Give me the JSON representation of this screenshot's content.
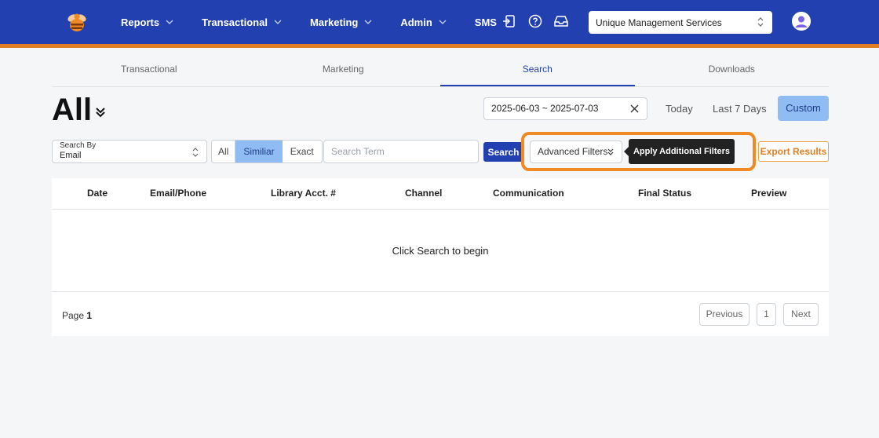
{
  "brand": {
    "logo": "bee-logo",
    "accent": "#2340b1",
    "stripe": "#e07e23"
  },
  "nav": {
    "items": [
      {
        "label": "Reports",
        "dropdown": true
      },
      {
        "label": "Transactional",
        "dropdown": true
      },
      {
        "label": "Marketing",
        "dropdown": true
      },
      {
        "label": "Admin",
        "dropdown": true
      },
      {
        "label": "SMS",
        "dropdown": false
      }
    ],
    "icons": [
      "logout-icon",
      "help-icon",
      "inbox-icon"
    ],
    "org_select": "Unique Management Services",
    "avatar": "user-avatar-icon"
  },
  "tabs": [
    {
      "label": "Transactional",
      "active": false
    },
    {
      "label": "Marketing",
      "active": false
    },
    {
      "label": "Search",
      "active": true
    },
    {
      "label": "Downloads",
      "active": false
    }
  ],
  "header": {
    "title": "All",
    "date_range": "2025-06-03 ~ 2025-07-03",
    "range_buttons": [
      "Today",
      "Last 7 Days",
      "Custom"
    ],
    "active_range": "Custom"
  },
  "filters": {
    "search_by_label": "Search By",
    "search_by_value": "Email",
    "match_modes": [
      "All",
      "Similiar",
      "Exact"
    ],
    "active_match": "Similiar",
    "search_placeholder": "Search Term",
    "search_button": "Search",
    "advanced_filters": "Advanced Filters",
    "tooltip": "Apply Additional Filters",
    "export_button": "Export Results"
  },
  "table": {
    "columns": [
      "Date",
      "Email/Phone",
      "Library Acct. #",
      "Channel",
      "Communication",
      "Final Status",
      "Preview"
    ],
    "empty_message": "Click Search to begin",
    "page_label": "Page",
    "page_number": "1",
    "prev_button": "Previous",
    "current_page": "1",
    "next_button": "Next"
  }
}
